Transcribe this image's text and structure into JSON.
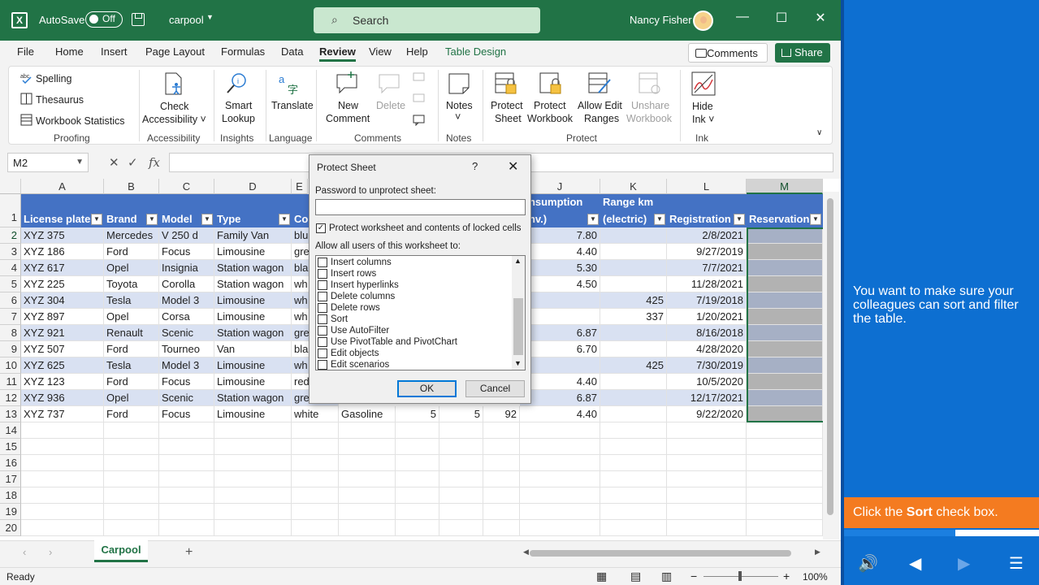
{
  "titlebar": {
    "autosave": "AutoSave",
    "autosave_state": "Off",
    "filename": "carpool",
    "search_placeholder": "Search",
    "user": "Nancy Fisher"
  },
  "tabs": [
    "File",
    "Home",
    "Insert",
    "Page Layout",
    "Formulas",
    "Data",
    "Review",
    "View",
    "Help",
    "Table Design"
  ],
  "active_tab": "Review",
  "buttons": {
    "comments": "Comments",
    "share": "Share"
  },
  "ribbon": {
    "proofing": {
      "spelling": "Spelling",
      "thesaurus": "Thesaurus",
      "stats": "Workbook Statistics",
      "label": "Proofing"
    },
    "accessibility": {
      "check1": "Check",
      "check2": "Accessibility ˅",
      "label": "Accessibility"
    },
    "insights": {
      "t1": "Smart",
      "t2": "Lookup",
      "label": "Insights"
    },
    "language": {
      "t1": "Translate",
      "label": "Language"
    },
    "comments": {
      "new1": "New",
      "new2": "Comment",
      "delete": "Delete",
      "label": "Comments"
    },
    "notes": {
      "t1": "Notes",
      "t2": "˅",
      "label": "Notes"
    },
    "protect": {
      "ps1": "Protect",
      "ps2": "Sheet",
      "pw1": "Protect",
      "pw2": "Workbook",
      "ae1": "Allow Edit",
      "ae2": "Ranges",
      "us1": "Unshare",
      "us2": "Workbook",
      "label": "Protect"
    },
    "ink": {
      "t1": "Hide",
      "t2": "Ink ˅",
      "label": "Ink"
    }
  },
  "namebox": "M2",
  "columns": [
    "A",
    "B",
    "C",
    "D",
    "E",
    "J",
    "K",
    "L",
    "M"
  ],
  "header_row": {
    "a": "License plate",
    "b": "Brand",
    "c": "Model",
    "d": "Type",
    "e": "Co",
    "j1": "onsumption",
    "j2": "onv.)",
    "k1": "Range km",
    "k2": "(electric)",
    "l": "Registration",
    "m": "Reservation"
  },
  "rows": [
    {
      "n": "2",
      "a": "XYZ 375",
      "b": "Mercedes",
      "c": "V 250 d",
      "d": "Family Van",
      "e": "blu",
      "j": "7.80",
      "k": "",
      "l": "2/8/2021"
    },
    {
      "n": "3",
      "a": "XYZ 186",
      "b": "Ford",
      "c": "Focus",
      "d": "Limousine",
      "e": "gre",
      "j": "4.40",
      "k": "",
      "l": "9/27/2019"
    },
    {
      "n": "4",
      "a": "XYZ 617",
      "b": "Opel",
      "c": "Insignia",
      "d": "Station wagon",
      "e": "bla",
      "j": "5.30",
      "k": "",
      "l": "7/7/2021"
    },
    {
      "n": "5",
      "a": "XYZ 225",
      "b": "Toyota",
      "c": "Corolla",
      "d": "Station wagon",
      "e": "wh",
      "j": "4.50",
      "k": "",
      "l": "11/28/2021"
    },
    {
      "n": "6",
      "a": "XYZ 304",
      "b": "Tesla",
      "c": "Model 3",
      "d": "Limousine",
      "e": "wh",
      "j": "",
      "k": "425",
      "l": "7/19/2018"
    },
    {
      "n": "7",
      "a": "XYZ 897",
      "b": "Opel",
      "c": "Corsa",
      "d": "Limousine",
      "e": "wh",
      "j": "",
      "k": "337",
      "l": "1/20/2021"
    },
    {
      "n": "8",
      "a": "XYZ 921",
      "b": "Renault",
      "c": "Scenic",
      "d": "Station wagon",
      "e": "gre",
      "j": "6.87",
      "k": "",
      "l": "8/16/2018"
    },
    {
      "n": "9",
      "a": "XYZ 507",
      "b": "Ford",
      "c": "Tourneo",
      "d": "Van",
      "e": "bla",
      "j": "6.70",
      "k": "",
      "l": "4/28/2020"
    },
    {
      "n": "10",
      "a": "XYZ 625",
      "b": "Tesla",
      "c": "Model 3",
      "d": "Limousine",
      "e": "wh",
      "j": "",
      "k": "425",
      "l": "7/30/2019"
    },
    {
      "n": "11",
      "a": "XYZ 123",
      "b": "Ford",
      "c": "Focus",
      "d": "Limousine",
      "e": "red",
      "j": "4.40",
      "k": "",
      "l": "10/5/2020"
    },
    {
      "n": "12",
      "a": "XYZ 936",
      "b": "Opel",
      "c": "Scenic",
      "d": "Station wagon",
      "e": "gre",
      "j": "6.87",
      "k": "",
      "l": "12/17/2021"
    },
    {
      "n": "13",
      "a": "XYZ 737",
      "b": "Ford",
      "c": "Focus",
      "d": "Limousine",
      "e": "white",
      "f": "Gasoline",
      "g": "5",
      "h": "5",
      "i": "92",
      "j": "4.40",
      "k": "",
      "l": "9/22/2020"
    }
  ],
  "empty_rows": [
    "14",
    "15",
    "16",
    "17",
    "18",
    "19",
    "20"
  ],
  "dialog": {
    "title": "Protect Sheet",
    "help": "?",
    "close": "✕",
    "pw_label": "Password to unprotect sheet:",
    "protect_label": "Protect worksheet and contents of locked cells",
    "allow_label": "Allow all users of this worksheet to:",
    "options": [
      "Insert columns",
      "Insert rows",
      "Insert hyperlinks",
      "Delete columns",
      "Delete rows",
      "Sort",
      "Use AutoFilter",
      "Use PivotTable and PivotChart",
      "Edit objects",
      "Edit scenarios"
    ],
    "ok": "OK",
    "cancel": "Cancel"
  },
  "sheet_tab": "Carpool",
  "status": {
    "ready": "Ready",
    "zoom": "100%"
  },
  "tutorial": {
    "message": "You want to make sure your colleagues can sort and filter the table.",
    "hint_pre": "Click the ",
    "hint_bold": "Sort",
    "hint_post": " check box.",
    "progress": 0.56
  }
}
